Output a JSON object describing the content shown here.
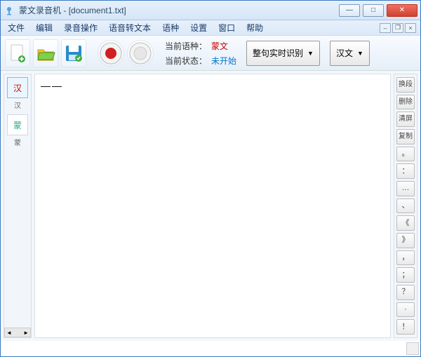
{
  "window": {
    "app_name": "蒙文录音机",
    "doc_name": "[document1.txt]",
    "title_sep": " - "
  },
  "menu": {
    "file": "文件",
    "edit": "编辑",
    "record_ops": "录音操作",
    "voice_to_text": "语音转文本",
    "language": "语种",
    "settings": "设置",
    "window": "窗口",
    "help": "帮助"
  },
  "status": {
    "lang_label": "当前语种：",
    "lang_value": "蒙文",
    "state_label": "当前状态：",
    "state_value": "未开始"
  },
  "dropdowns": {
    "recognition_mode": "整句实时识别",
    "output_lang": "汉文"
  },
  "tabs": {
    "han": "汉",
    "mon": "蒙",
    "han_small": "汉",
    "mon_small": "蒙"
  },
  "editor": {
    "text": "——"
  },
  "right_buttons": {
    "b0": "换段",
    "b1": "删除",
    "b2": "清屏",
    "b3": "复制",
    "b4": "。",
    "b5": "：",
    "b6": "…",
    "b7": "、",
    "b8": "《",
    "b9": "》",
    "b10": "，",
    "b11": "；",
    "b12": "？",
    "b13": "·",
    "b14": "！"
  }
}
